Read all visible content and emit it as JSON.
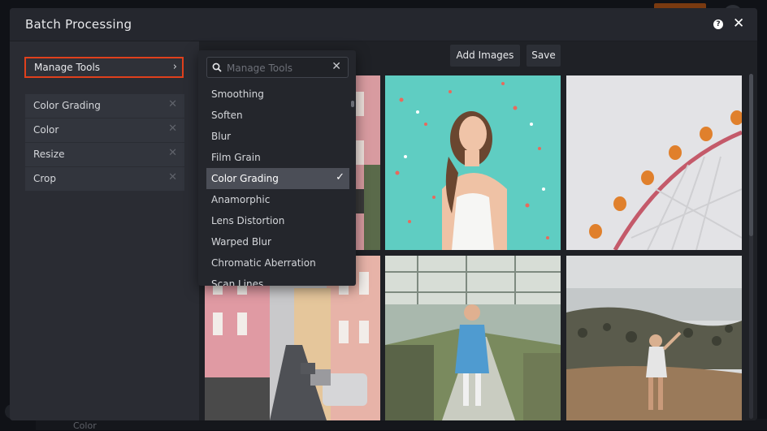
{
  "background": {
    "bottom_text": "Color"
  },
  "window": {
    "title": "Batch Processing"
  },
  "sidebar": {
    "manage_label": "Manage Tools",
    "tools": [
      {
        "label": "Color Grading"
      },
      {
        "label": "Color"
      },
      {
        "label": "Resize"
      },
      {
        "label": "Crop"
      }
    ]
  },
  "toolbar": {
    "add_images_label": "Add Images",
    "save_label": "Save"
  },
  "dropdown": {
    "search_placeholder": "Manage Tools",
    "items": [
      {
        "label": "Smoothing",
        "selected": false
      },
      {
        "label": "Soften",
        "selected": false
      },
      {
        "label": "Blur",
        "selected": false
      },
      {
        "label": "Film Grain",
        "selected": false
      },
      {
        "label": "Color Grading",
        "selected": true
      },
      {
        "label": "Anamorphic",
        "selected": false
      },
      {
        "label": "Lens Distortion",
        "selected": false
      },
      {
        "label": "Warped Blur",
        "selected": false
      },
      {
        "label": "Chromatic Aberration",
        "selected": false
      },
      {
        "label": "Scan Lines",
        "selected": false
      }
    ]
  },
  "gallery": {
    "images": [
      {
        "subject": "pink-city-buildings"
      },
      {
        "subject": "woman-confetti-teal"
      },
      {
        "subject": "ferris-wheel"
      },
      {
        "subject": "street-pink-buildings"
      },
      {
        "subject": "woman-greenhouse"
      },
      {
        "subject": "woman-hill-view"
      }
    ]
  },
  "colors": {
    "accent_outline": "#e0401c",
    "modal_bg": "#2a2c33",
    "selected_item": "#4b4e57"
  }
}
